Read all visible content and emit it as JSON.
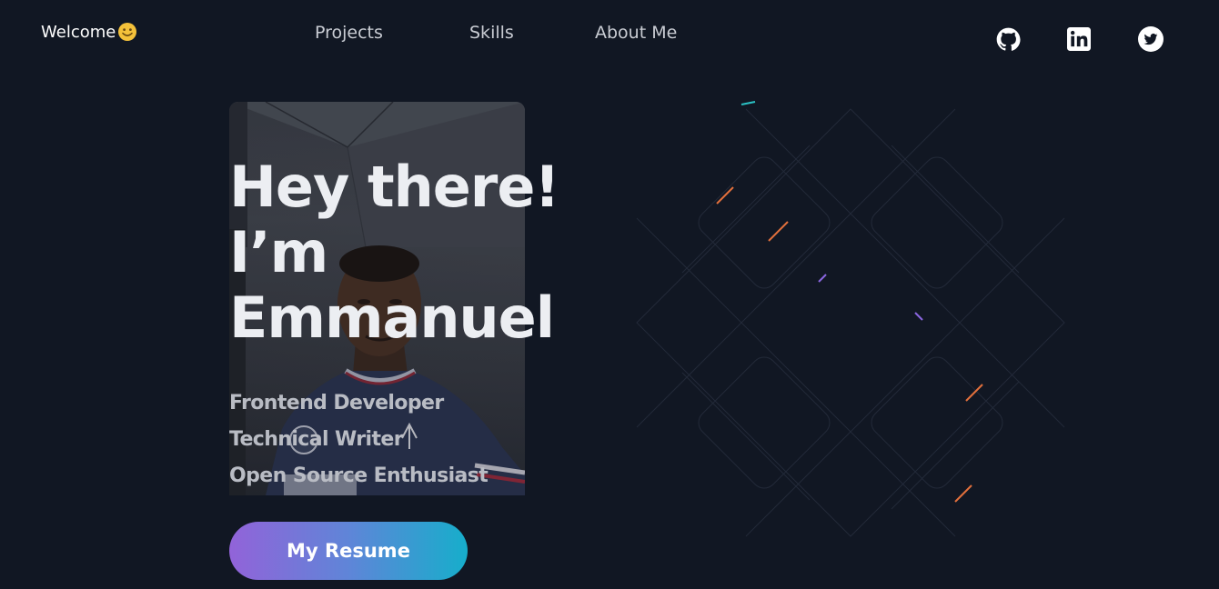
{
  "header": {
    "brand": "Welcome",
    "nav": [
      {
        "label": "Projects"
      },
      {
        "label": "Skills"
      },
      {
        "label": "About Me"
      }
    ],
    "social": [
      {
        "icon": "github-icon"
      },
      {
        "icon": "linkedin-icon"
      },
      {
        "icon": "twitter-icon"
      }
    ]
  },
  "hero": {
    "title_lines": [
      "Hey there!",
      "I’m",
      "Emmanuel"
    ],
    "roles": [
      "Frontend Developer",
      "Technical Writer",
      "Open Source Enthusiast"
    ],
    "cta": "My Resume"
  },
  "colors": {
    "background": "#111723",
    "button_gradient_start": "#9263d9",
    "button_gradient_end": "#16aecb"
  }
}
